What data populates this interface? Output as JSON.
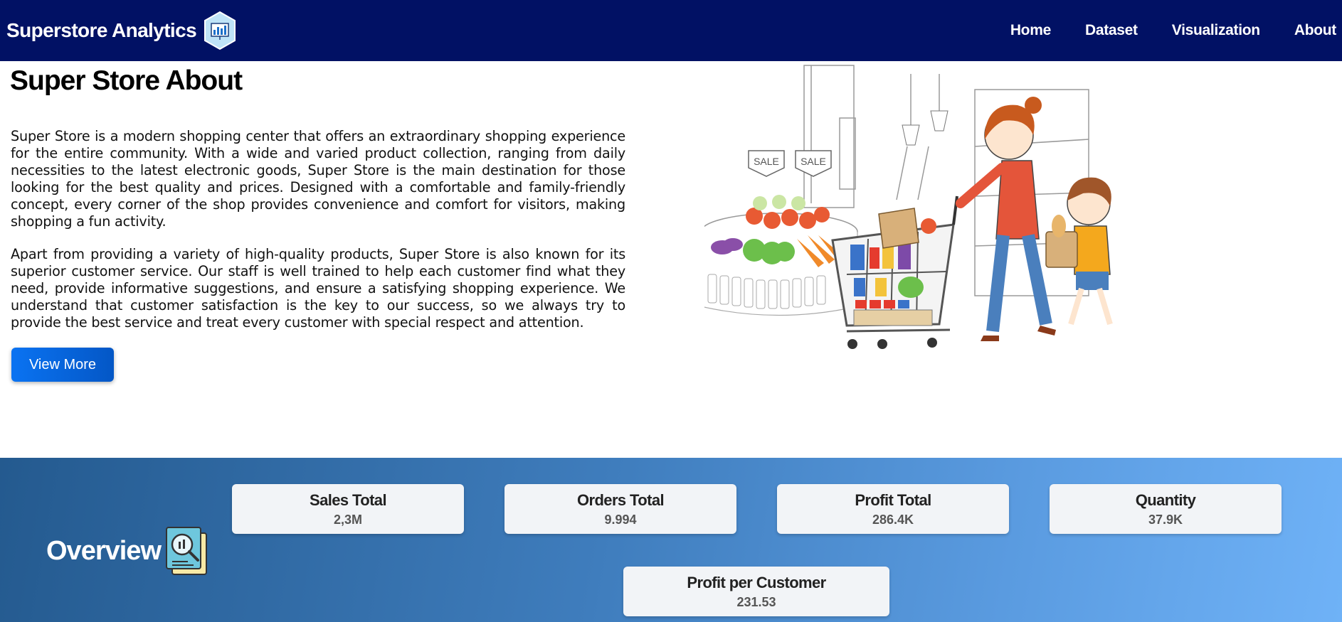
{
  "navbar": {
    "brand": "Superstore Analytics",
    "links": [
      "Home",
      "Dataset",
      "Visualization",
      "About"
    ]
  },
  "about": {
    "title": "Super Store About",
    "paragraphs": [
      "Super Store is a modern shopping center that offers an extraordinary shopping experience for the entire community. With a wide and varied product collection, ranging from daily necessities to the latest electronic goods, Super Store is the main destination for those looking for the best quality and prices. Designed with a comfortable and family-friendly concept, every corner of the shop provides convenience and comfort for visitors, making shopping a fun activity.",
      "Apart from providing a variety of high-quality products, Super Store is also known for its superior customer service. Our staff is well trained to help each customer find what they need, provide informative suggestions, and ensure a satisfying shopping experience. We understand that customer satisfaction is the key to our success, so we always try to provide the best service and treat every customer with special respect and attention."
    ],
    "button_label": "View More",
    "illustration_signs": [
      "SALE",
      "SALE"
    ]
  },
  "overview": {
    "title": "Overview",
    "cards": [
      {
        "label": "Sales Total",
        "value": "2,3M"
      },
      {
        "label": "Orders Total",
        "value": "9.994"
      },
      {
        "label": "Profit Total",
        "value": "286.4K"
      },
      {
        "label": "Quantity",
        "value": "37.9K"
      },
      {
        "label": "Profit per Customer",
        "value": "231.53"
      }
    ]
  },
  "colors": {
    "navbar_bg": "#011164",
    "button_bg": "#0a73f2",
    "overview_gradient_start": "#245a8f",
    "overview_gradient_end": "#6fb2f7",
    "card_bg": "#f2f4f7"
  },
  "icons": {
    "brand_logo": "analytics-hexagon-icon",
    "overview_icon": "report-magnifier-icon"
  }
}
